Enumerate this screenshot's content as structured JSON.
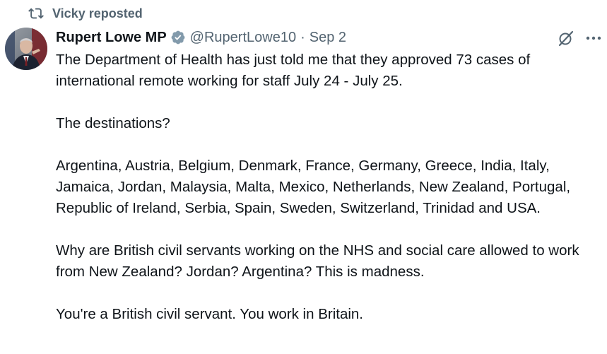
{
  "repost": {
    "label": "Vicky reposted",
    "icon": "repost-icon"
  },
  "author": {
    "name": "Rupert Lowe MP",
    "handle": "@RupertLowe10",
    "separator": "·",
    "date": "Sep 2",
    "verified_icon": "gray-verified-badge-icon",
    "verified_color": "#829aab"
  },
  "actions": {
    "grok_icon": "grok-icon",
    "more_icon": "more-options-icon"
  },
  "tweet": {
    "paragraphs": [
      "The Department of Health has just told me that they approved 73 cases of international remote working for staff July 24 - July 25.",
      "The destinations?",
      "Argentina, Austria, Belgium, Denmark, France, Germany, Greece, India, Italy, Jamaica, Jordan, Malaysia, Malta, Mexico, Netherlands, New Zealand, Portugal, Republic of Ireland, Serbia, Spain, Sweden, Switzerland, Trinidad and USA.",
      "Why are British civil servants working on the NHS and social care allowed to work from New Zealand? Jordan? Argentina? This is madness.",
      "You're a British civil servant. You work in Britain."
    ]
  },
  "colors": {
    "text": "#0f1419",
    "secondary": "#536471",
    "background": "#ffffff"
  }
}
